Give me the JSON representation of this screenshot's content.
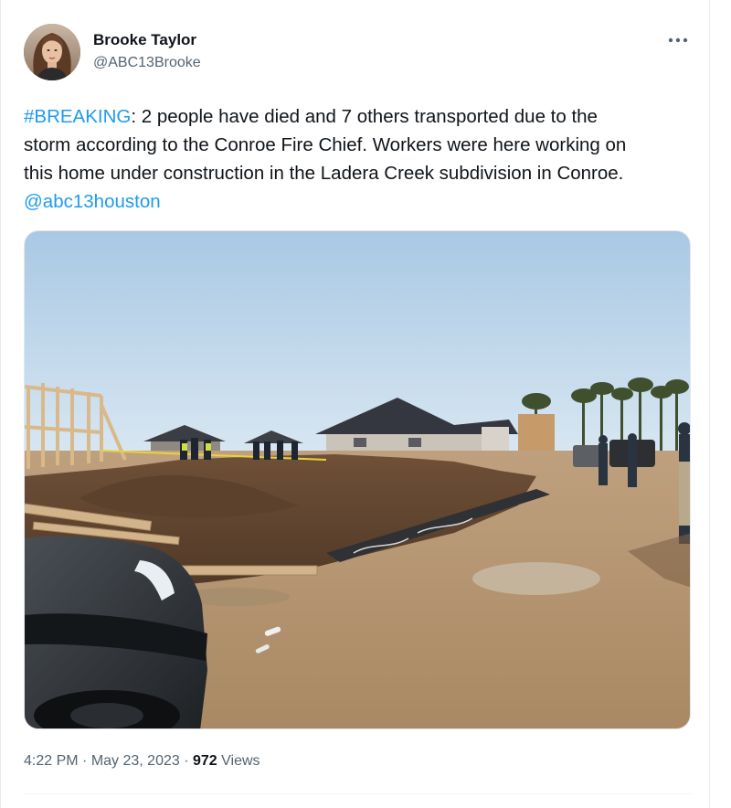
{
  "user": {
    "display_name": "Brooke Taylor",
    "handle": "@ABC13Brooke",
    "avatar_icon": "profile-photo"
  },
  "more_icon": "more-dots-icon",
  "tweet": {
    "hashtag": "#BREAKING",
    "line1_rest": ": 2 people have died and 7 others transported due to the",
    "line2": "storm  according to the Conroe Fire Chief. Workers were here working on",
    "line3": "this home under construction in the Ladera Creek subdivision in Conroe.",
    "mention": "@abc13houston",
    "link_color": "#1d9bf0"
  },
  "media": {
    "photo_icon": "storm-damage-photo"
  },
  "meta": {
    "time": "4:22 PM",
    "separator": " · ",
    "date": "May 23, 2023",
    "views_count": "972",
    "views_label": " Views"
  }
}
